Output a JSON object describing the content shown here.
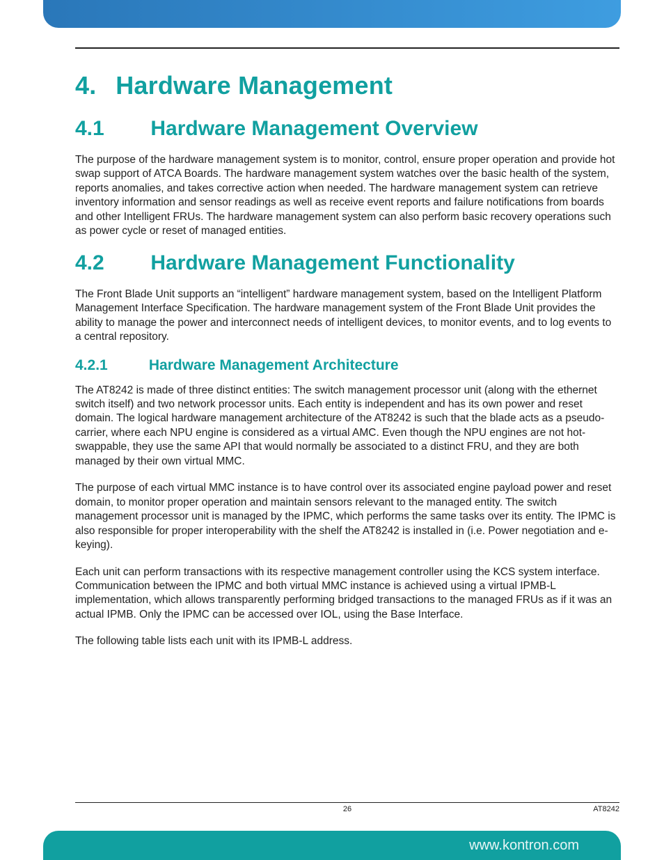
{
  "chapter": {
    "number": "4.",
    "title": "Hardware Management"
  },
  "sections": {
    "s41": {
      "number": "4.1",
      "title": "Hardware Management Overview",
      "p1": "The purpose of the hardware management system is to monitor, control, ensure proper operation and provide hot swap support of ATCA Boards. The hardware management system watches over the basic health of the system, reports anomalies, and takes corrective action when needed. The hardware management system can retrieve inventory information and sensor readings as well as receive event reports and failure notifications from boards and other Intelligent FRUs. The hardware management system can also perform basic recovery operations such as power cycle or reset of managed entities."
    },
    "s42": {
      "number": "4.2",
      "title": "Hardware Management Functionality",
      "p1": "The Front Blade Unit supports an “intelligent” hardware management system, based on the Intelligent Platform Management Interface Specification. The hardware management system of the Front Blade Unit provides the ability to manage the power and interconnect needs of intelligent devices, to monitor events, and to log events to a central repository."
    },
    "s421": {
      "number": "4.2.1",
      "title": "Hardware Management Architecture",
      "p1": "The AT8242 is made of three distinct entities: The switch management processor unit (along with the ethernet switch itself) and two network processor units. Each entity is independent and has its own power and reset domain. The logical hardware management architecture of the AT8242 is such that the blade acts as a pseudo-carrier, where each NPU engine is considered as a virtual AMC. Even though the NPU engines are not hot-swappable, they use the same API that would normally be associated to a distinct FRU, and they are both managed by their own virtual MMC.",
      "p2": "The purpose of each virtual MMC instance is to have control over its associated engine payload power and reset domain, to monitor proper operation and maintain sensors relevant to the managed entity. The switch management processor unit is managed by the IPMC, which performs the same tasks over its entity. The IPMC is also responsible for proper interoperability with the shelf the AT8242 is installed in (i.e. Power negotiation and e-keying).",
      "p3": "Each unit can perform transactions with its respective management controller using the KCS system interface. Communication between the IPMC and both virtual MMC instance is achieved using a virtual IPMB-L implementation, which allows transparently performing bridged transactions to the managed FRUs as if it was an actual IPMB. Only the IPMC can be accessed over IOL, using the Base Interface.",
      "p4": "The following table lists each unit with its IPMB-L address."
    }
  },
  "footer": {
    "page_number": "26",
    "doc_code": "AT8242",
    "website": "www.kontron.com"
  }
}
